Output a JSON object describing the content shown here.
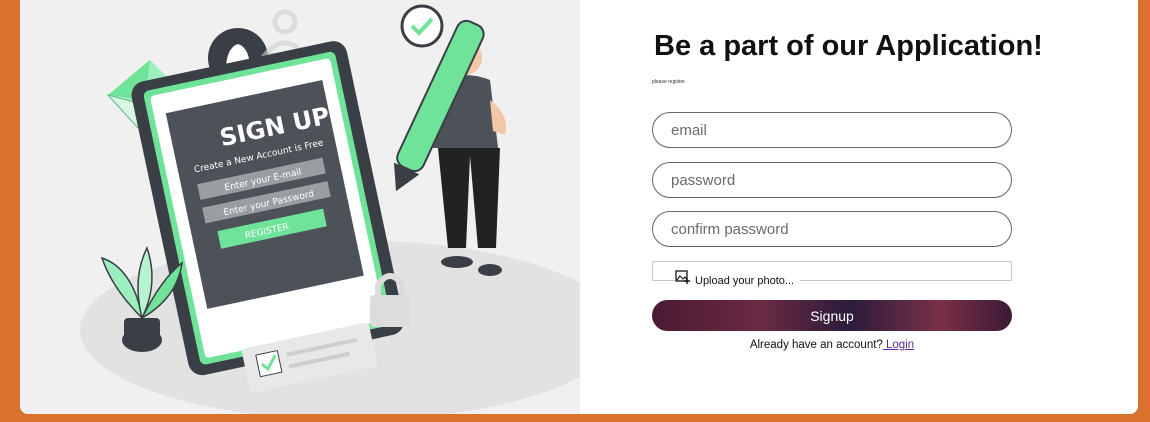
{
  "colors": {
    "frame": "#d9722c",
    "accent_green": "#6fe39a",
    "button_gradient_start": "#4a1a32",
    "button_gradient_end": "#3b1a34",
    "link": "#5a2aa0"
  },
  "illustration": {
    "heading": "SIGN UP",
    "subheading": "Create a New Account is Free",
    "email_hint": "Enter your E-mail",
    "password_hint": "Enter your Password",
    "register_label": "REGISTER"
  },
  "form": {
    "title": "Be a part of our Application!",
    "subtitle": "please register.",
    "email_placeholder": "email",
    "password_placeholder": "password",
    "confirm_placeholder": "confirm password",
    "upload_label": "Upload your photo...",
    "upload_icon": "image-plus-icon",
    "signup_label": "Signup",
    "login_prompt": "Already have an account?",
    "login_link": " Login"
  }
}
